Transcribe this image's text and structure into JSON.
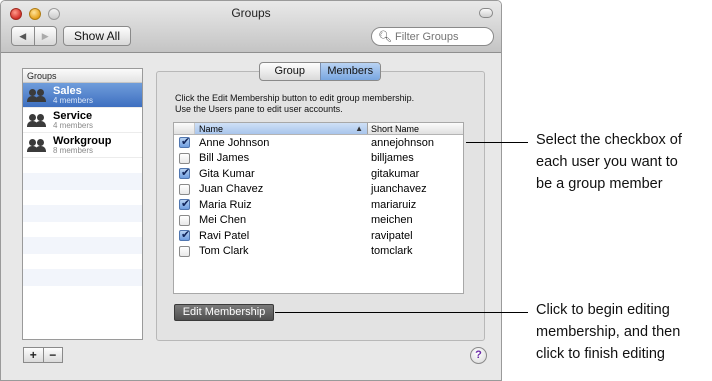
{
  "window": {
    "title": "Groups",
    "toolbar": {
      "back": "◀",
      "forward": "▶",
      "show_all": "Show All"
    },
    "filter_placeholder": "Filter Groups"
  },
  "groups": {
    "header": "Groups",
    "items": [
      {
        "name": "Sales",
        "count": "4 members",
        "selected": true
      },
      {
        "name": "Service",
        "count": "4 members",
        "selected": false
      },
      {
        "name": "Workgroup",
        "count": "8 members",
        "selected": false
      }
    ],
    "add": "+",
    "remove": "−"
  },
  "tabs": [
    {
      "label": "Group",
      "active": false
    },
    {
      "label": "Members",
      "active": true
    }
  ],
  "instructions": {
    "line1": "Click the Edit Membership button to edit group membership.",
    "line2": "Use the Users pane to edit user accounts."
  },
  "members_table": {
    "columns": {
      "name": "Name",
      "short_name": "Short Name",
      "sort_icon": "▲"
    },
    "rows": [
      {
        "checked": true,
        "name": "Anne Johnson",
        "short": "annejohnson"
      },
      {
        "checked": false,
        "name": "Bill James",
        "short": "billjames"
      },
      {
        "checked": true,
        "name": "Gita Kumar",
        "short": "gitakumar"
      },
      {
        "checked": false,
        "name": "Juan Chavez",
        "short": "juanchavez"
      },
      {
        "checked": true,
        "name": "Maria Ruiz",
        "short": "mariaruiz"
      },
      {
        "checked": false,
        "name": "Mei Chen",
        "short": "meichen"
      },
      {
        "checked": true,
        "name": "Ravi Patel",
        "short": "ravipatel"
      },
      {
        "checked": false,
        "name": "Tom Clark",
        "short": "tomclark"
      }
    ]
  },
  "edit_button": "Edit Membership",
  "help": "?",
  "callouts": {
    "top": [
      "Select the checkbox of",
      "each user you want to",
      "be a group member"
    ],
    "bottom": [
      "Click to begin editing",
      "membership, and then",
      "click to finish editing"
    ]
  }
}
